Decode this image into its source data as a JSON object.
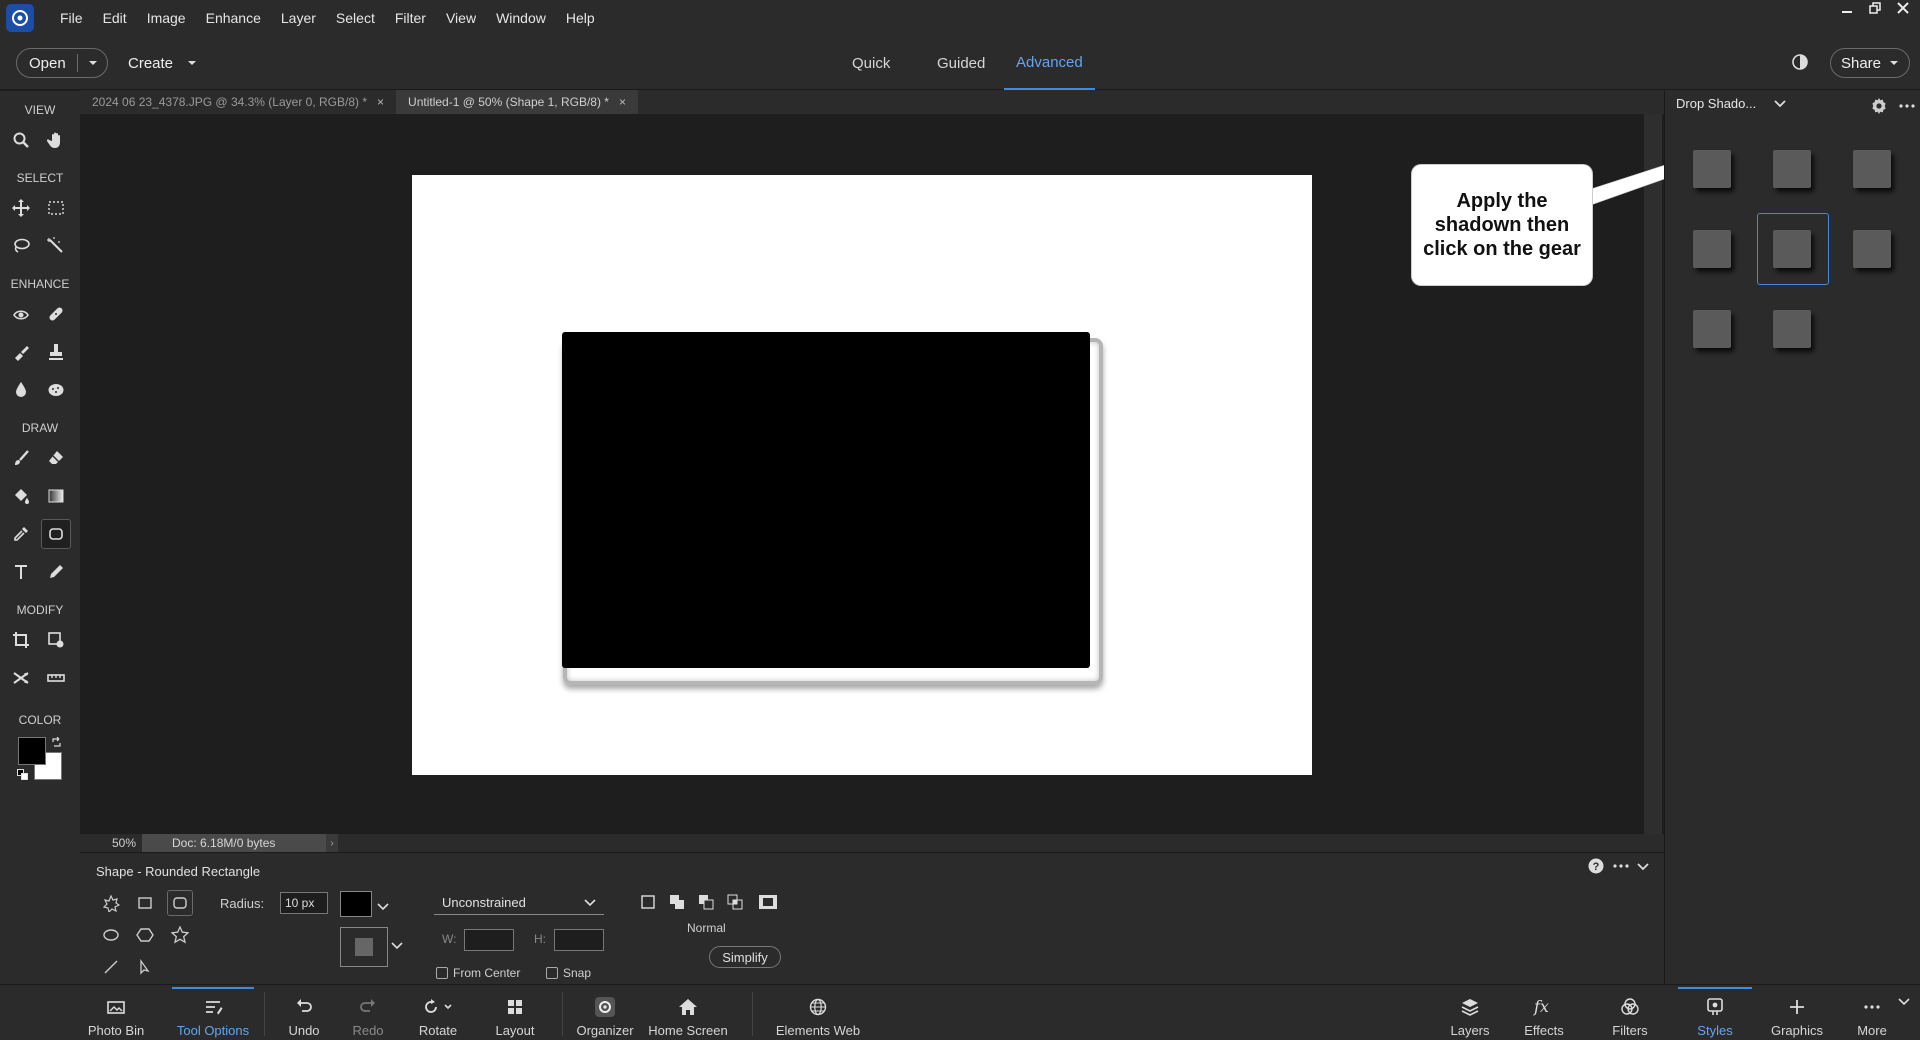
{
  "menu": [
    "File",
    "Edit",
    "Image",
    "Enhance",
    "Layer",
    "Select",
    "Filter",
    "View",
    "Window",
    "Help"
  ],
  "window_controls": [
    "minimize",
    "restore",
    "close"
  ],
  "topbar": {
    "open_label": "Open",
    "create_label": "Create",
    "modes": [
      "Quick",
      "Guided",
      "Advanced"
    ],
    "active_mode": "Advanced",
    "share_label": "Share"
  },
  "toolbox": {
    "sections": {
      "view": "VIEW",
      "select": "SELECT",
      "enhance": "ENHANCE",
      "draw": "DRAW",
      "modify": "MODIFY",
      "color": "COLOR"
    },
    "foreground_color": "#000000",
    "background_color": "#ffffff"
  },
  "doc_tabs": [
    {
      "label": "2024 06 23_4378.JPG @ 34.3% (Layer 0, RGB/8) *",
      "close": "×"
    },
    {
      "label": "Untitled-1 @ 50% (Shape 1, RGB/8) *",
      "close": "×"
    }
  ],
  "callout": {
    "text": "Apply the shadown then click on the gear"
  },
  "status": {
    "zoom": "50%",
    "doc_info": "Doc: 6.18M/0 bytes",
    "arrow": "›"
  },
  "right_panel": {
    "dropdown_label": "Drop Shado...",
    "swatch_count": 8,
    "selected_index": 4
  },
  "tool_options": {
    "title": "Shape - Rounded Rectangle",
    "radius_label": "Radius:",
    "radius_value": "10 px",
    "constraint": "Unconstrained",
    "w_label": "W:",
    "h_label": "H:",
    "from_center": "From Center",
    "snap": "Snap",
    "blend_mode": "Normal",
    "simplify": "Simplify",
    "shape_color": "#000000"
  },
  "bottombar": {
    "photo_bin": "Photo Bin",
    "tool_options": "Tool Options",
    "undo": "Undo",
    "redo": "Redo",
    "rotate": "Rotate",
    "layout": "Layout",
    "organizer": "Organizer",
    "home_screen": "Home Screen",
    "elements_web": "Elements Web",
    "layers": "Layers",
    "effects": "Effects",
    "filters": "Filters",
    "styles": "Styles",
    "graphics": "Graphics",
    "more": "More"
  },
  "accent_color": "#3e8be0"
}
